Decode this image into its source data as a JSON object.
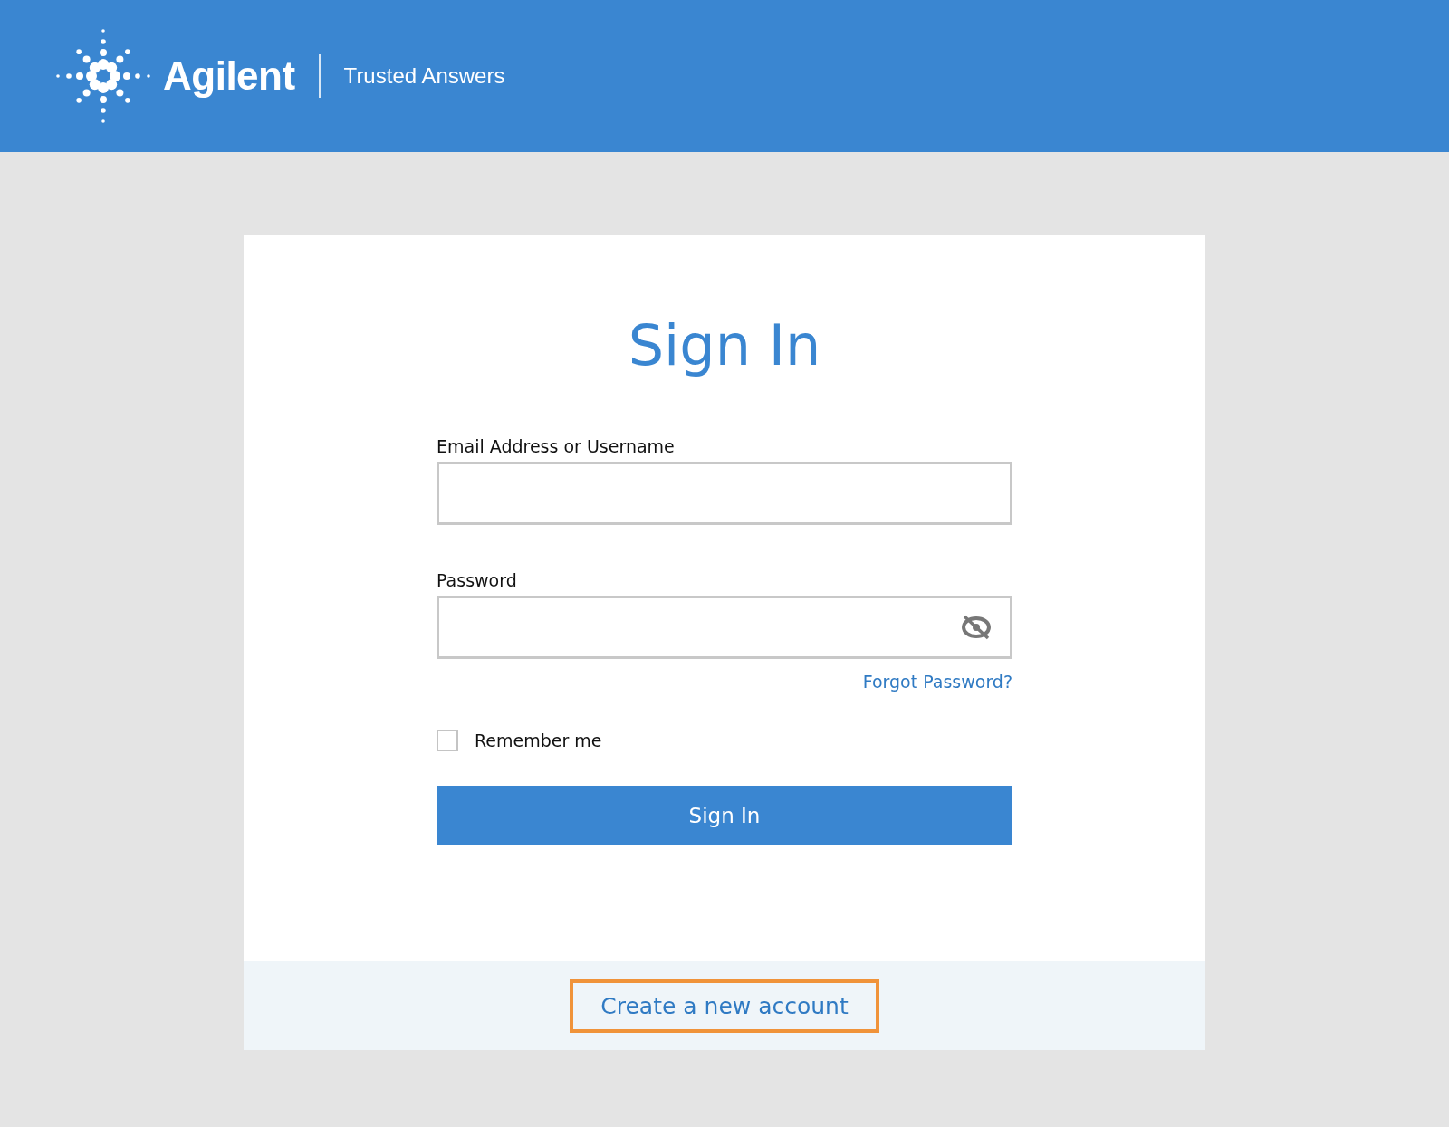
{
  "header": {
    "brand": "Agilent",
    "tagline": "Trusted Answers"
  },
  "form": {
    "title": "Sign In",
    "fields": [
      {
        "kind": "text",
        "label": "Email Address or Username"
      },
      {
        "kind": "password",
        "label": "Password",
        "password_hidden": true
      }
    ],
    "forgot_link": "Forgot Password?",
    "remember": {
      "label": "Remember me",
      "checked": false
    },
    "submit": "Sign In"
  },
  "footer": {
    "create_link": "Create a new account",
    "highlighted": true
  }
}
